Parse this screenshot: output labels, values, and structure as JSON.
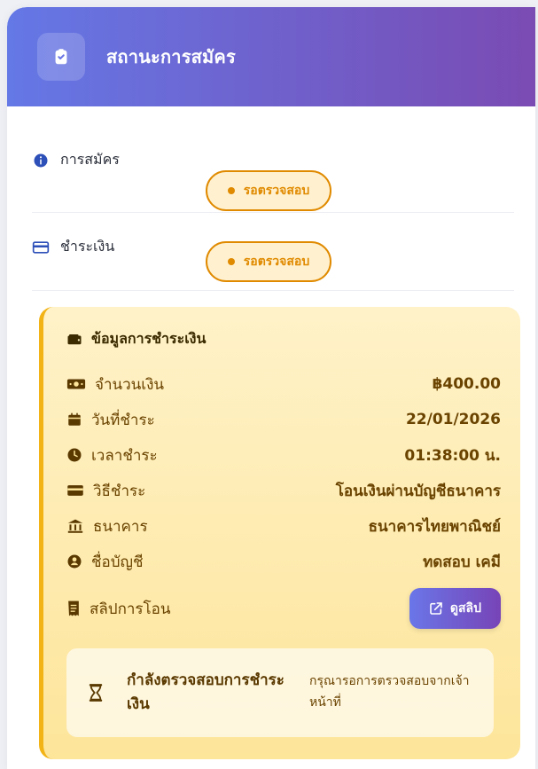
{
  "header": {
    "title": "สถานะการสมัคร",
    "icon": "clipboard-check-icon",
    "gradient": [
      "#6478e6",
      "#7a4bb3"
    ]
  },
  "status_rows": [
    {
      "label": "การสมัคร",
      "icon": "info-icon",
      "badge": "รอตรวจสอบ"
    },
    {
      "label": "ชำระเงิน",
      "icon": "credit-card-icon",
      "badge": "รอตรวจสอบ"
    }
  ],
  "payment_info": {
    "title": "ข้อมูลการชำระเงิน",
    "title_icon": "wallet-icon",
    "items": [
      {
        "label": "จำนวนเงิน",
        "value": "฿400.00",
        "icon": "money-icon"
      },
      {
        "label": "วันที่ชำระ",
        "value": "22/01/2026",
        "icon": "calendar-icon"
      },
      {
        "label": "เวลาชำระ",
        "value": "01:38:00 น.",
        "icon": "clock-icon"
      },
      {
        "label": "วิธีชำระ",
        "value": "โอนเงินผ่านบัญชีธนาคาร",
        "icon": "card-icon"
      },
      {
        "label": "ธนาคาร",
        "value": "ธนาคารไทยพาณิชย์",
        "icon": "bank-icon"
      },
      {
        "label": "ชื่อบัญชี",
        "value": "ทดสอบ เคมี",
        "icon": "user-circle-icon"
      }
    ],
    "slip": {
      "label": "สลิปการโอน",
      "button_label": "ดูสลิป",
      "icon": "receipt-icon",
      "button_icon": "external-link-icon"
    },
    "notice": {
      "title": "กำลังตรวจสอบการชำระเงิน",
      "desc": "กรุณารอการตรวจสอบจากเจ้าหน้าที่",
      "icon": "hourglass-icon"
    }
  }
}
